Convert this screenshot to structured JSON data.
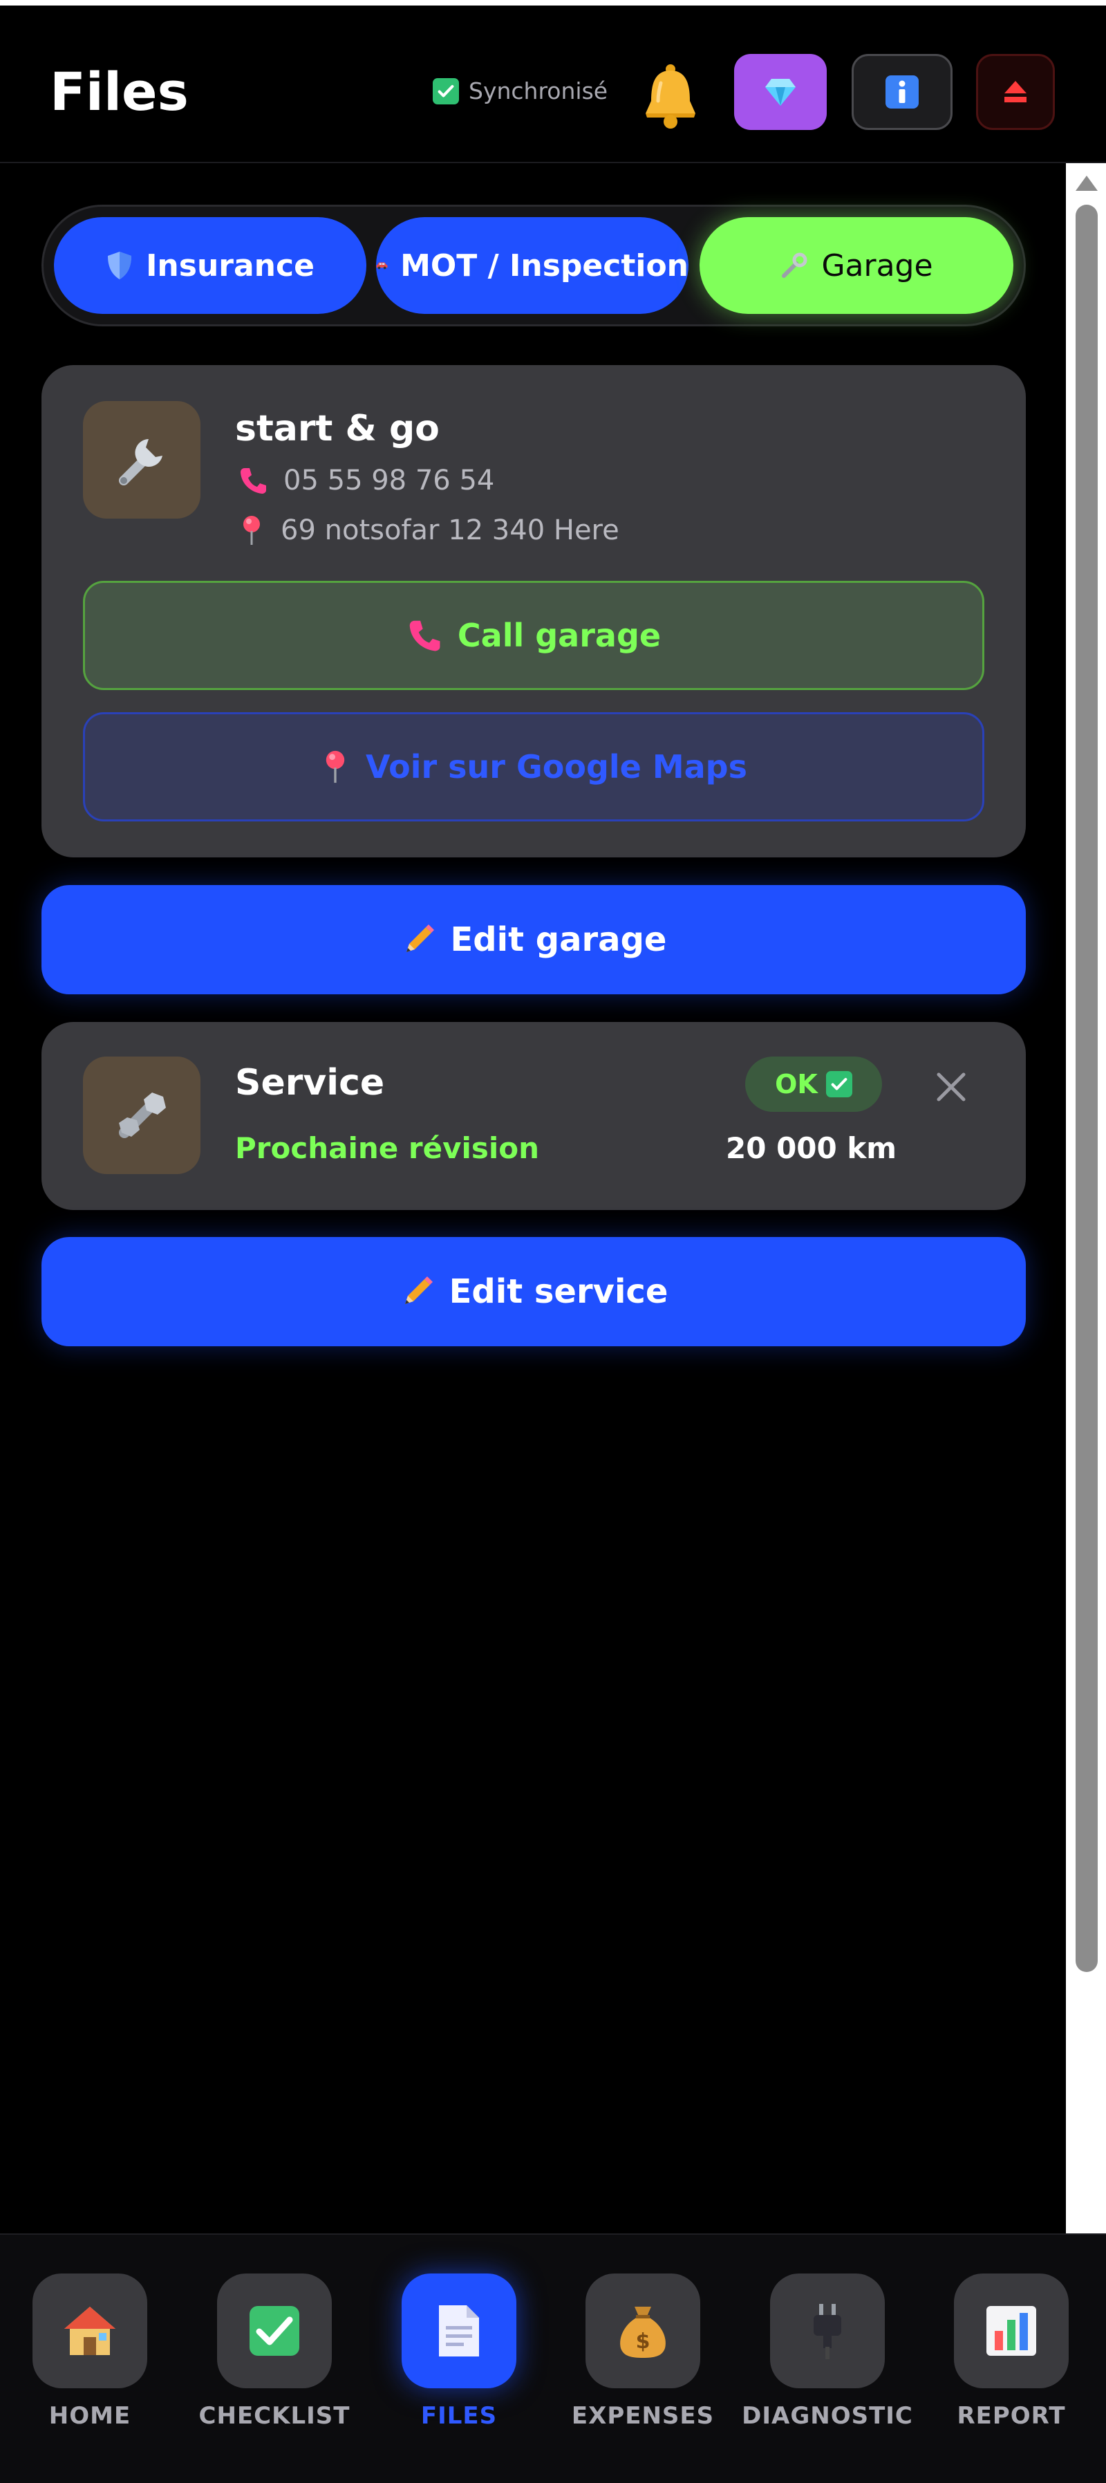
{
  "header": {
    "title": "Files",
    "sync_label": "Synchronisé",
    "icons": {
      "notifications": "bell-icon",
      "premium": "gem-icon",
      "info": "info-icon",
      "logout": "eject-icon"
    }
  },
  "tabs": [
    {
      "label": "Insurance",
      "icon": "shield-icon",
      "active": false
    },
    {
      "label": "MOT / Inspection",
      "icon": "car-icon",
      "active": false
    },
    {
      "label": "Garage",
      "icon": "wrench-icon",
      "active": true
    }
  ],
  "garage": {
    "name": "start & go",
    "phone": "05 55 98 76 54",
    "address": "69 notsofar 12 340 Here",
    "call_label": "Call garage",
    "maps_label": "Voir sur Google Maps",
    "edit_label": "Edit garage"
  },
  "service": {
    "title": "Service",
    "next_label": "Prochaine révision",
    "next_value": "20 000 km",
    "status": "OK",
    "edit_label": "Edit service"
  },
  "nav": [
    {
      "label": "HOME",
      "icon": "house-icon",
      "active": false
    },
    {
      "label": "CHECKLIST",
      "icon": "checkmark-icon",
      "active": false
    },
    {
      "label": "FILES",
      "icon": "document-icon",
      "active": true
    },
    {
      "label": "EXPENSES",
      "icon": "money-bag-icon",
      "active": false
    },
    {
      "label": "DIAGNOSTIC",
      "icon": "plug-icon",
      "active": false
    },
    {
      "label": "REPORT",
      "icon": "bar-chart-icon",
      "active": false
    }
  ],
  "colors": {
    "accent_blue": "#2050ff",
    "accent_green": "#80ff5a",
    "card_bg": "#3a3a3e",
    "background": "#000000"
  }
}
